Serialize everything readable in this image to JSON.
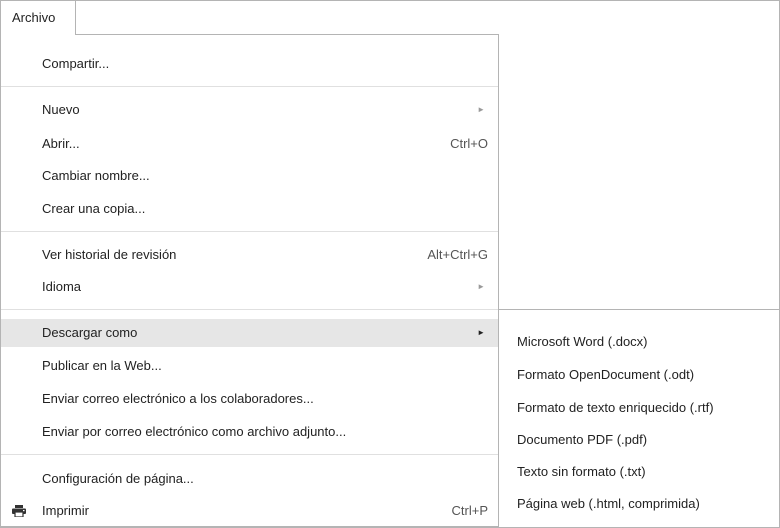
{
  "menubar": {
    "file_menu_label": "Archivo"
  },
  "file_menu": {
    "share": "Compartir...",
    "new": "Nuevo",
    "open": "Abrir...",
    "open_shortcut": "Ctrl+O",
    "rename": "Cambiar nombre...",
    "make_copy": "Crear una copia...",
    "revision_history": "Ver historial de revisión",
    "revision_history_shortcut": "Alt+Ctrl+G",
    "language": "Idioma",
    "download_as": "Descargar como",
    "publish_web": "Publicar en la Web...",
    "email_collaborators": "Enviar correo electrónico a los colaboradores...",
    "email_attachment": "Enviar por correo electrónico como archivo adjunto...",
    "page_setup": "Configuración de página...",
    "print": "Imprimir",
    "print_shortcut": "Ctrl+P",
    "submenu_arrow": "►",
    "print_icon": "printer-icon"
  },
  "download_submenu": {
    "items": [
      "Microsoft Word (.docx)",
      "Formato OpenDocument (.odt)",
      "Formato de texto enriquecido (.rtf)",
      "Documento PDF (.pdf)",
      "Texto sin formato (.txt)",
      "Página web (.html, comprimida)"
    ]
  },
  "colors": {
    "highlight": "#e6e6e6",
    "border": "#b4b4b4",
    "separator": "#e0e0e0"
  }
}
